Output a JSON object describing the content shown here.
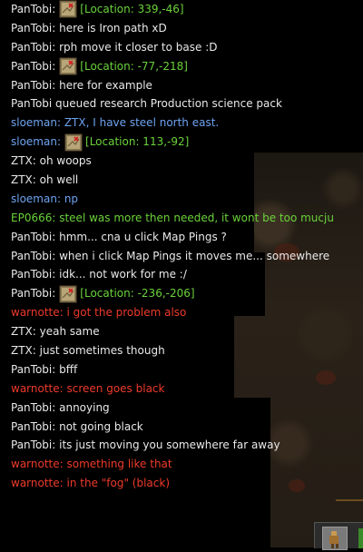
{
  "chat": [
    {
      "user": "PanTobi",
      "color": "white",
      "ping": true,
      "location": "[Location: 339,-46]"
    },
    {
      "user": "PanTobi",
      "color": "white",
      "text": "here is Iron path xD"
    },
    {
      "user": "PanTobi",
      "color": "white",
      "text": "rph move it closer to base :D"
    },
    {
      "user": "PanTobi",
      "color": "white",
      "ping": true,
      "location": "[Location: -77,-218]"
    },
    {
      "user": "PanTobi",
      "color": "white",
      "text": "here for example"
    },
    {
      "system": "PanTobi queued research Production science pack",
      "color": "white"
    },
    {
      "user": "sloeman",
      "color": "blue",
      "text": "ZTX, I have steel north east."
    },
    {
      "user": "sloeman",
      "color": "blue",
      "ping": true,
      "location": "[Location: 113,-92]"
    },
    {
      "user": "ZTX",
      "color": "white",
      "text": "oh woops"
    },
    {
      "user": "ZTX",
      "color": "white",
      "text": "oh well"
    },
    {
      "user": "sloeman",
      "color": "blue",
      "text": "np"
    },
    {
      "user": "EP0666",
      "color": "green",
      "text": "steel was more then needed, it wont be too mucju"
    },
    {
      "user": "PanTobi",
      "color": "white",
      "text": "hmm... cna u click Map Pings ?"
    },
    {
      "user": "PanTobi",
      "color": "white",
      "text": "when i click Map Pings it moves me... somewhere"
    },
    {
      "user": "PanTobi",
      "color": "white",
      "text": "idk... not work for me :/"
    },
    {
      "user": "PanTobi",
      "color": "white",
      "ping": true,
      "location": "[Location: -236,-206]"
    },
    {
      "user": "warnotte",
      "color": "red",
      "text": "i got the problem also"
    },
    {
      "user": "ZTX",
      "color": "white",
      "text": "yeah same"
    },
    {
      "user": "ZTX",
      "color": "white",
      "text": "just sometimes though"
    },
    {
      "user": "PanTobi",
      "color": "white",
      "text": "bfff"
    },
    {
      "user": "warnotte",
      "color": "red",
      "text": "screen goes black"
    },
    {
      "user": "PanTobi",
      "color": "white",
      "text": "annoying"
    },
    {
      "user": "PanTobi",
      "color": "white",
      "text": "not going black"
    },
    {
      "user": "PanTobi",
      "color": "white",
      "text": "its just moving you somewhere far away"
    },
    {
      "user": "warnotte",
      "color": "red",
      "text": "something like that"
    },
    {
      "user": "warnotte",
      "color": "red",
      "text": "in the \"fog\" (black)"
    }
  ],
  "colors": {
    "white": "#e9e9e9",
    "blue": "#6da3f0",
    "red": "#ee3a2a",
    "green": "#6ad23a",
    "location": "#6ad23a"
  },
  "icons": {
    "ping": "map-ping-icon",
    "toolbar_slot": "weapon-slot-icon"
  }
}
